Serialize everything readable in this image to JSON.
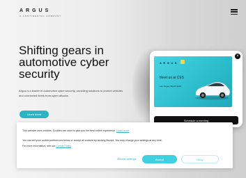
{
  "header": {
    "logo_text": "ARGUS",
    "logo_subtext": "A CONTINENTAL COMPANY",
    "menu_icon": "hamburger-menu-icon"
  },
  "hero": {
    "headline": "Shifting gears in automotive cyber security",
    "subtext": "Argus is a leader in automotive cyber security, providing solutions to protect vehicles and connected fleets from cyber attacks.",
    "cta_label": "Learn more"
  },
  "promo": {
    "close_icon": "close-icon",
    "logo_text": "ARGUS",
    "title": "Meet us at CES",
    "subtitle": "Las Vegas, Booth 1234",
    "button_label": "Schedule a meeting",
    "banner_color": "#2bbccc"
  },
  "cookie_banner": {
    "line1": "This website uses cookies. Cookies are used to give you the best online experience.",
    "line1_link": "Learn more",
    "line2": "You can set your cookie preferences below or accept all cookies by clicking Accept. You may change your settings at any time.",
    "line3": "For more information, see our",
    "line3_link": "Cookie Policy",
    "settings_label": "Cookie settings",
    "accept_label": "Accept",
    "deny_label": "Deny"
  },
  "colors": {
    "accent": "#2ab5c4",
    "accept_button": "#3ed0e0",
    "dark": "#111111"
  }
}
